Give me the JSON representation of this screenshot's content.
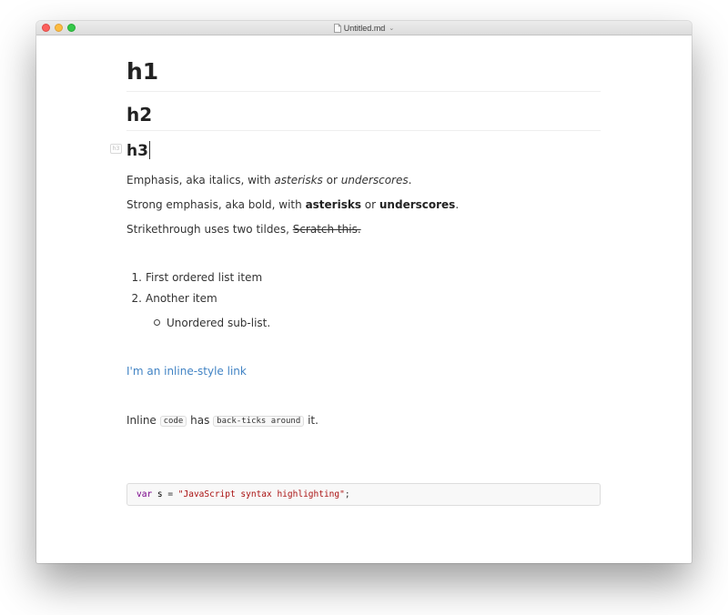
{
  "window": {
    "title": "Untitled.md"
  },
  "icons": {
    "document": "document-icon",
    "dropdown": "chevron-down-icon",
    "heading_marker": "h3-marker"
  },
  "colors": {
    "link": "#4183c4",
    "keyword": "#770088",
    "string": "#aa1111",
    "close": "#fc605c",
    "minimize": "#fdbc40",
    "zoom": "#34c84a"
  },
  "editor": {
    "h1": "h1",
    "h2": "h2",
    "h3": "h3",
    "heading_marker": "h3",
    "emphasis": {
      "prefix": "Emphasis, aka italics, with ",
      "em1": "asterisks",
      "mid": " or ",
      "em2": "underscores",
      "suffix": "."
    },
    "strong": {
      "prefix": "Strong emphasis, aka bold, with ",
      "b1": "asterisks",
      "mid": " or ",
      "b2": "underscores",
      "suffix": "."
    },
    "strikethrough": {
      "prefix": "Strikethrough uses two tildes, ",
      "struck": "Scratch this."
    },
    "ordered_list": [
      {
        "num": "1.",
        "text": "First ordered list item"
      },
      {
        "num": "2.",
        "text": "Another item"
      }
    ],
    "unordered_sublist": [
      {
        "text": "Unordered sub-list."
      }
    ],
    "link_text": "I'm an inline-style link",
    "inline_code": {
      "prefix": "Inline ",
      "code1": "code",
      "mid": " has ",
      "code2": "back-ticks around",
      "suffix": " it."
    },
    "code_block": {
      "keyword": "var",
      "variable": " s",
      "operator": " = ",
      "string": "\"JavaScript syntax highlighting\"",
      "terminator": ";"
    }
  }
}
